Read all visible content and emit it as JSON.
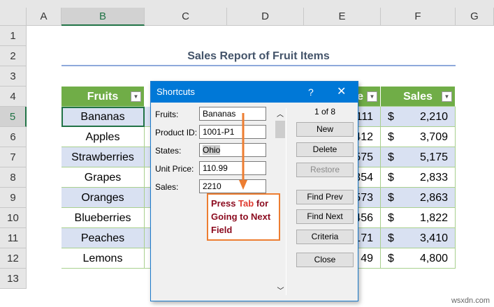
{
  "columns": [
    "A",
    "B",
    "C",
    "D",
    "E",
    "F",
    "G"
  ],
  "rows": [
    "1",
    "2",
    "3",
    "4",
    "5",
    "6",
    "7",
    "8",
    "9",
    "10",
    "11",
    "12",
    "13"
  ],
  "title": "Sales Report of Fruit Items",
  "headers": {
    "fruits": "Fruits",
    "price_partial": "e",
    "sales": "Sales"
  },
  "fruits": [
    "Bananas",
    "Apples",
    "Strawberries",
    "Grapes",
    "Oranges",
    "Blueberries",
    "Peaches",
    "Lemons"
  ],
  "price_partial": [
    "111",
    "412",
    "575",
    "354",
    "573",
    "456",
    "171",
    "49"
  ],
  "currency": "$",
  "sales": [
    "2,210",
    "3,709",
    "5,175",
    "2,833",
    "2,863",
    "1,822",
    "3,410",
    "4,800"
  ],
  "dialog": {
    "title": "Shortcuts",
    "help": "?",
    "close": "✕",
    "labels": [
      "Fruits:",
      "Product ID:",
      "States:",
      "Unit Price:",
      "Sales:"
    ],
    "values": [
      "Bananas",
      "1001-P1",
      "Ohio",
      "110.99",
      "2210"
    ],
    "record": "1 of 8",
    "buttons": [
      "New",
      "Delete",
      "Restore",
      "Find Prev",
      "Find Next",
      "Criteria",
      "Close"
    ]
  },
  "callout": {
    "pre": "Press ",
    "key": "Tab",
    "post": " for Going to Next Field"
  },
  "watermark": "wsxdn.com"
}
